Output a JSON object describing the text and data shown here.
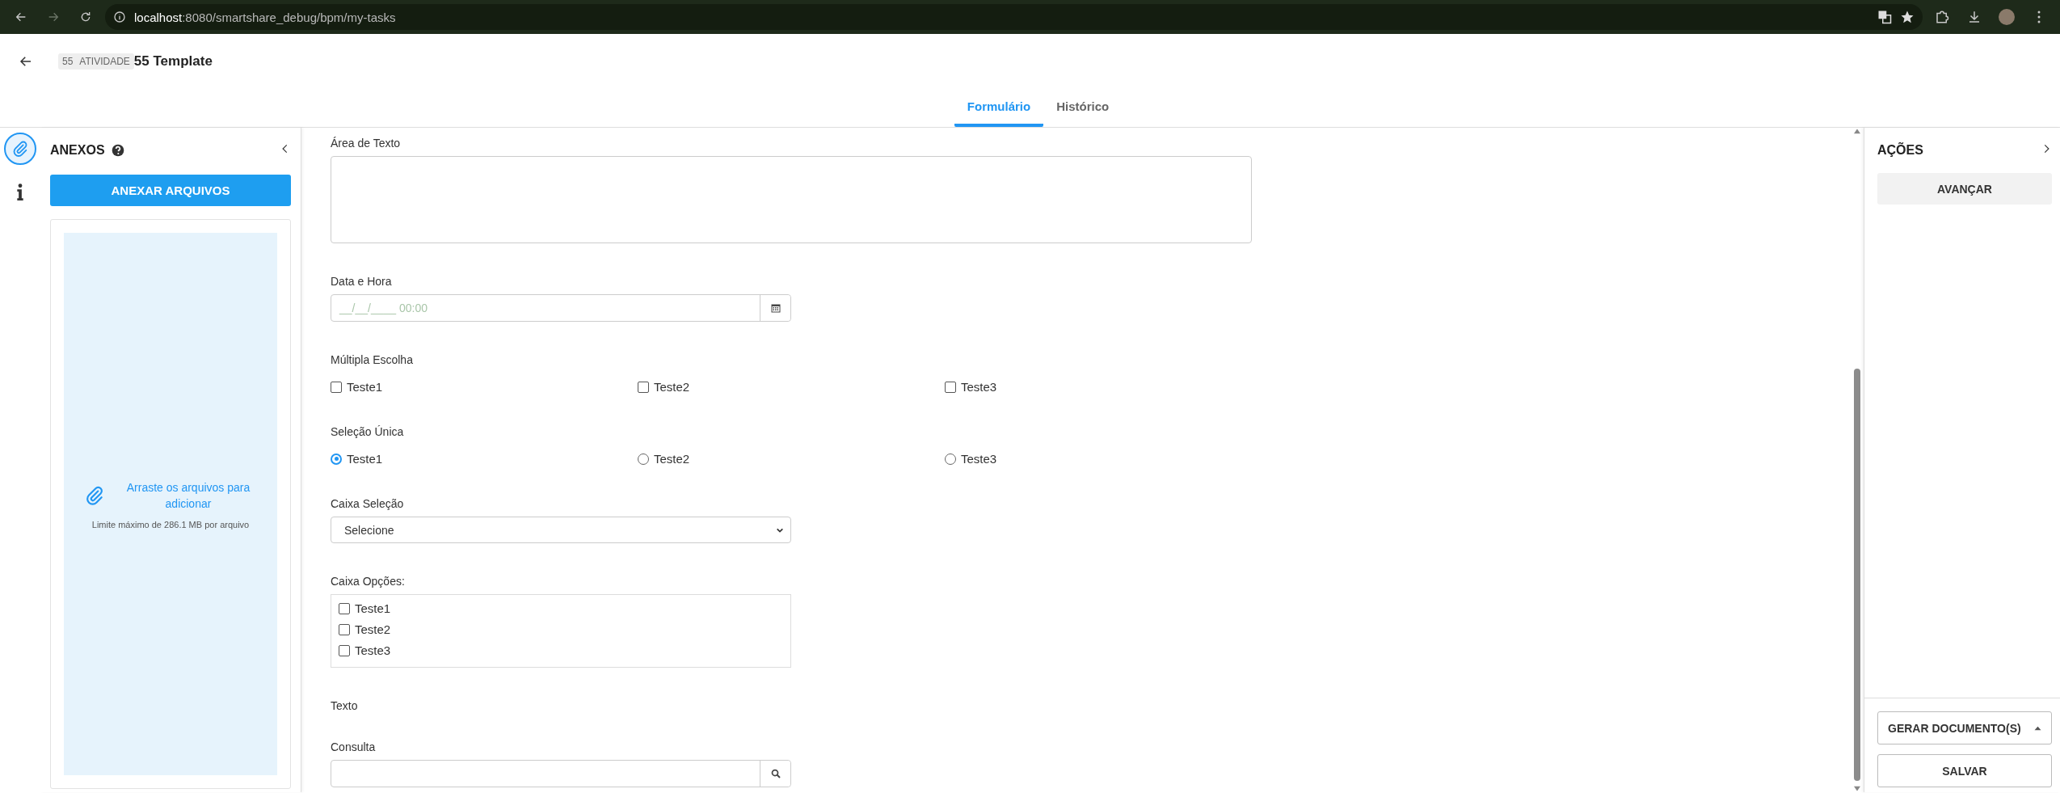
{
  "browser": {
    "address_host": "localhost",
    "address_path": ":8080/smartshare_debug/bpm/my-tasks"
  },
  "header": {
    "badge_number": "55",
    "badge_label": "ATIVIDADE",
    "title": "55 Template"
  },
  "tabs": [
    {
      "label": "Formulário",
      "selected": true
    },
    {
      "label": "Histórico",
      "selected": false
    }
  ],
  "side_icons": [
    {
      "kind": "attach",
      "selected": true
    },
    {
      "kind": "info",
      "selected": false
    }
  ],
  "attachments": {
    "title": "ANEXOS",
    "button": "ANEXAR ARQUIVOS",
    "drop_text": "Arraste os arquivos para adicionar",
    "limit": "Limite máximo de 286.1 MB por arquivo"
  },
  "form": {
    "fields": [
      {
        "kind": "textarea",
        "label": "Área de Texto"
      },
      {
        "kind": "datetime",
        "label": "Data e Hora",
        "placeholder": "__/__/____ 00:00"
      },
      {
        "kind": "checkboxes",
        "label": "Múltipla Escolha",
        "options": [
          {
            "label": "Teste1",
            "checked": false
          },
          {
            "label": "Teste2",
            "checked": false
          },
          {
            "label": "Teste3",
            "checked": false
          }
        ]
      },
      {
        "kind": "radios",
        "label": "Seleção Única",
        "options": [
          {
            "label": "Teste1",
            "selected": true
          },
          {
            "label": "Teste2",
            "selected": false
          },
          {
            "label": "Teste3",
            "selected": false
          }
        ]
      },
      {
        "kind": "select",
        "label": "Caixa Seleção",
        "value": "Selecione"
      },
      {
        "kind": "checklist",
        "label": "Caixa Opções:",
        "options": [
          {
            "label": "Teste1",
            "checked": false
          },
          {
            "label": "Teste2",
            "checked": false
          },
          {
            "label": "Teste3",
            "checked": false
          }
        ]
      },
      {
        "kind": "text",
        "label": "Texto"
      },
      {
        "kind": "lookup",
        "label": "Consulta"
      }
    ]
  },
  "actions": {
    "title": "AÇÕES",
    "buttons": [
      "AVANÇAR"
    ],
    "footer": [
      {
        "kind": "dropdown",
        "label": "GERAR DOCUMENTO(S)"
      },
      {
        "kind": "plain",
        "label": "SALVAR"
      }
    ]
  }
}
